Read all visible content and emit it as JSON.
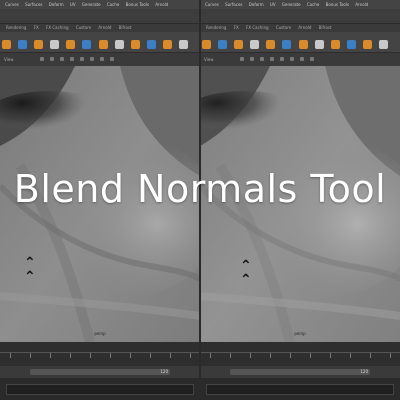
{
  "title": "Blend Normals Tool",
  "menus": [
    "Curves",
    "Surfaces",
    "Deform",
    "UV",
    "Generate",
    "Cache",
    "Bonus Tools",
    "Arnold",
    "Mesh Display"
  ],
  "shelf_tabs": [
    "Rendering",
    "FX",
    "FX Caching",
    "Custom",
    "Arnold",
    "Bifrost",
    "MASH"
  ],
  "viewport_menus": [
    "View",
    "Shading",
    "Lighting",
    "Show",
    "Renderer",
    "Panels"
  ],
  "left_view": {
    "hud": "persp"
  },
  "right_view": {
    "hud": "persp"
  },
  "range_value": "120",
  "colors": {
    "ui_bg": "#444444",
    "shelf_icon": "#d98a2b",
    "skin": "#8a8a8a"
  }
}
